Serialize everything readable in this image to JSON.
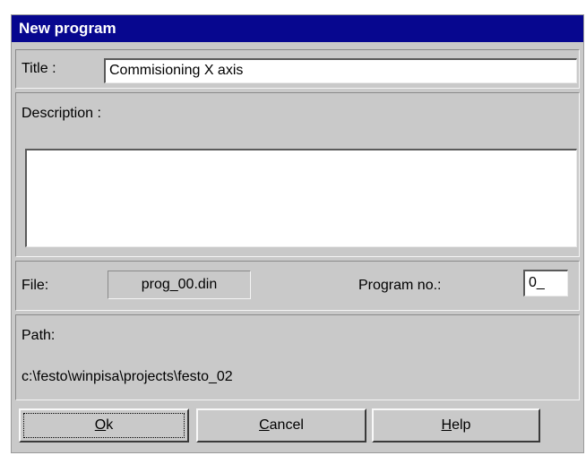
{
  "dialog": {
    "title": "New program"
  },
  "title_field": {
    "label": "Title :",
    "value": "Commisioning X axis"
  },
  "description": {
    "label": "Description :",
    "value": ""
  },
  "file": {
    "label": "File:",
    "value": "prog_00.din"
  },
  "program_no": {
    "label": "Program no.:",
    "value": "0_"
  },
  "path": {
    "label": "Path:",
    "value": "c:\\festo\\winpisa\\projects\\festo_02"
  },
  "buttons": {
    "ok": {
      "mnemonic": "O",
      "rest": "k"
    },
    "cancel": {
      "mnemonic": "C",
      "rest": "ancel"
    },
    "help": {
      "mnemonic": "H",
      "rest": "elp"
    }
  }
}
